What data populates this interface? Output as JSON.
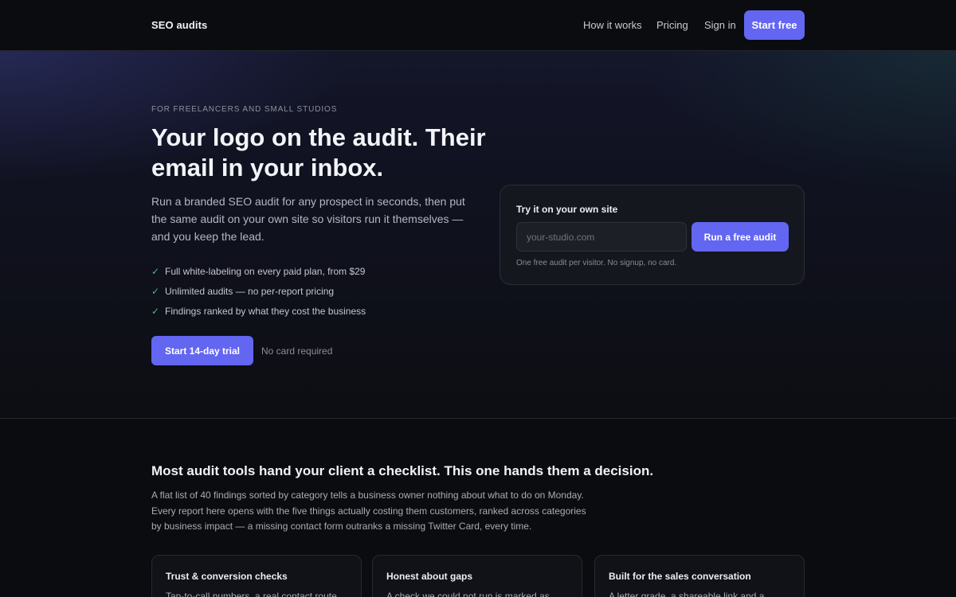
{
  "nav": {
    "brand": "SEO audits",
    "links": [
      "How it works",
      "Pricing",
      "Sign in"
    ],
    "cta": "Start free"
  },
  "hero": {
    "eyebrow": "FOR FREELANCERS AND SMALL STUDIOS",
    "headline": "Your logo on the audit. Their email in your inbox.",
    "lede": "Run a branded SEO audit for any prospect in seconds, then put the same audit on your own site so visitors run it themselves — and you keep the lead.",
    "checks": [
      "Full white-labeling on every paid plan, from $29",
      "Unlimited audits — no per-report pricing",
      "Findings ranked by what they cost the business"
    ],
    "check_icon": "✓",
    "trial_button": "Start 14-day trial",
    "trial_note": "No card required"
  },
  "try_card": {
    "title": "Try it on your own site",
    "placeholder": "your-studio.com",
    "button": "Run a free audit",
    "note": "One free audit per visitor. No signup, no card."
  },
  "section2": {
    "title": "Most audit tools hand your client a checklist. This one hands them a decision.",
    "body": "A flat list of 40 findings sorted by category tells a business owner nothing about what to do on Monday. Every report here opens with the five things actually costing them customers, ranked across categories by business impact — a missing contact form outranks a missing Twitter Card, every time.",
    "cards": [
      {
        "title": "Trust & conversion checks",
        "text": "Tap-to-call numbers, a real contact route,"
      },
      {
        "title": "Honest about gaps",
        "text": "A check we could not run is marked as"
      },
      {
        "title": "Built for the sales conversation",
        "text": "A letter grade, a shareable link and a"
      }
    ]
  },
  "colors": {
    "accent": "#6366f1",
    "check": "#3fbf7f",
    "background": "#0c0d11"
  }
}
